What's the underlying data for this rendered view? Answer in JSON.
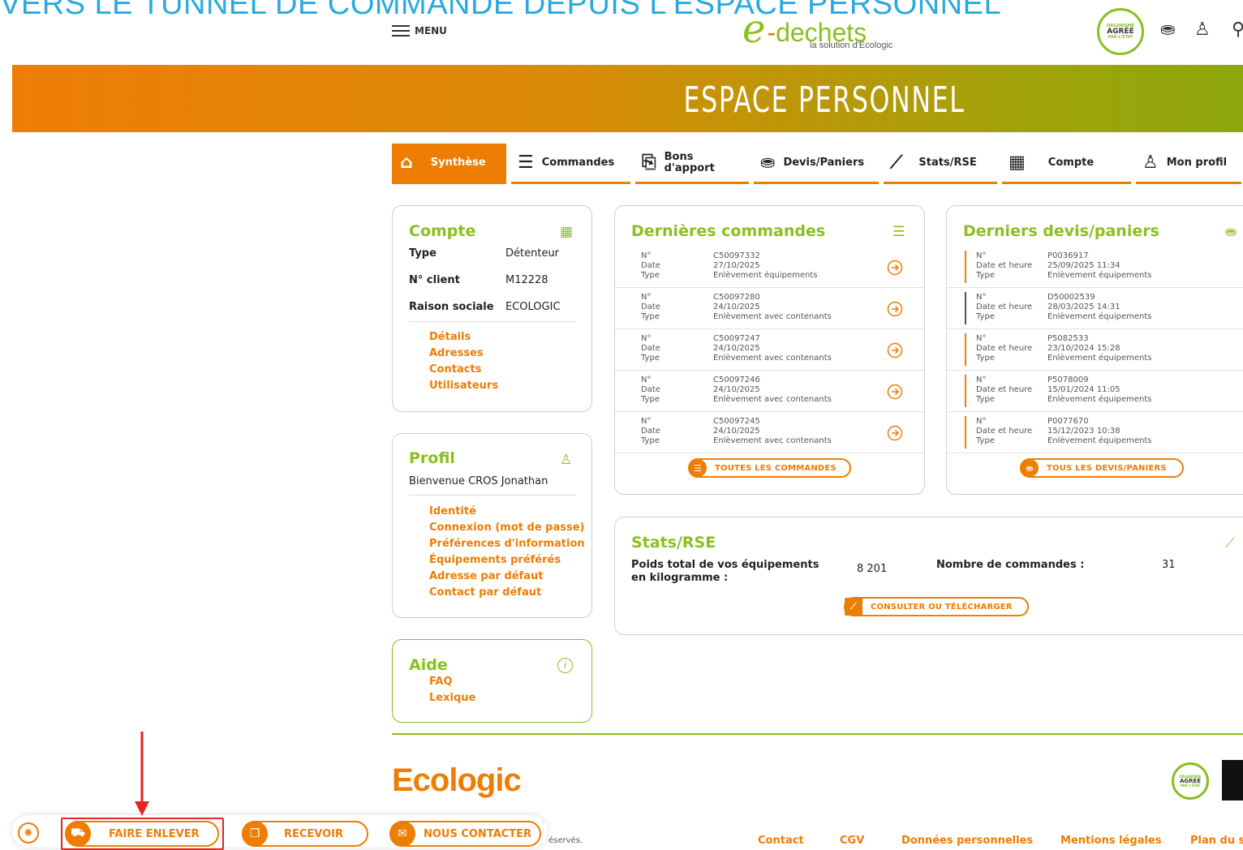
{
  "tutorial_caption": "VERS LE TUNNEL DE COMMANDE DEPUIS L'ESPACE PERSONNEL",
  "header": {
    "menu_label": "MENU",
    "logo": {
      "e": "e",
      "dash": "-",
      "word": "dechets",
      "tagline": "la solution d'Ecologic"
    },
    "seal": {
      "l1": "ORGANISME",
      "l2": "AGRÉÉ",
      "l3": "PAR L'ÉTAT"
    },
    "icons": [
      "basket-icon",
      "user-icon",
      "search-icon"
    ]
  },
  "banner": {
    "title": "ESPACE PERSONNEL"
  },
  "tabs": [
    {
      "label": "Synthèse",
      "icon": "⌂"
    },
    {
      "label": "Commandes",
      "icon": "☰"
    },
    {
      "label": "Bons d'apport",
      "icon": "⎘"
    },
    {
      "label": "Devis/Paniers",
      "icon": "⛂"
    },
    {
      "label": "Stats/RSE",
      "icon": "⟋"
    },
    {
      "label": "Compte",
      "icon": "▦"
    },
    {
      "label": "Mon profil",
      "icon": "♙"
    }
  ],
  "compte": {
    "title": "Compte",
    "type_label": "Type",
    "type_value": "Détenteur",
    "client_label": "N° client",
    "client_value": "M12228",
    "raison_label": "Raison sociale",
    "raison_value": "ECOLOGIC",
    "links": [
      "Détails",
      "Adresses",
      "Contacts",
      "Utilisateurs"
    ]
  },
  "profil": {
    "title": "Profil",
    "welcome": "Bienvenue CROS Jonathan",
    "links": [
      "Identité",
      "Connexion (mot de passe)",
      "Préférences d'information",
      "Équipements préférés",
      "Adresse par défaut",
      "Contact par défaut"
    ]
  },
  "aide": {
    "title": "Aide",
    "links": [
      "FAQ",
      "Lexique"
    ]
  },
  "commandes": {
    "title": "Dernières commandes",
    "labels": [
      "N°",
      "Date",
      "Type"
    ],
    "rows": [
      {
        "num": "C50097332",
        "date": "27/10/2025",
        "type": "Enlèvement équipements"
      },
      {
        "num": "C50097280",
        "date": "24/10/2025",
        "type": "Enlèvement avec contenants"
      },
      {
        "num": "C50097247",
        "date": "24/10/2025",
        "type": "Enlèvement avec contenants"
      },
      {
        "num": "C50097246",
        "date": "24/10/2025",
        "type": "Enlèvement avec contenants"
      },
      {
        "num": "C50097245",
        "date": "24/10/2025",
        "type": "Enlèvement avec contenants"
      }
    ],
    "button": "TOUTES LES COMMANDES"
  },
  "devis": {
    "title": "Derniers devis/paniers",
    "labels": [
      "N°",
      "Date et heure",
      "Type"
    ],
    "rows": [
      {
        "num": "P0036917",
        "date": "25/09/2025 11:34",
        "type": "Enlèvement équipements"
      },
      {
        "num": "D50002539",
        "date": "28/03/2025 14:31",
        "type": "Enlèvement équipements"
      },
      {
        "num": "P5082533",
        "date": "23/10/2024 15:28",
        "type": "Enlèvement équipements"
      },
      {
        "num": "P5078009",
        "date": "15/01/2024 11:05",
        "type": "Enlèvement équipements"
      },
      {
        "num": "P0077670",
        "date": "15/12/2023 10:38",
        "type": "Enlèvement équipements"
      }
    ],
    "button": "TOUS LES DEVIS/PANIERS"
  },
  "stats": {
    "title": "Stats/RSE",
    "poids_label": "Poids total de vos équipements en kilogramme :",
    "poids_value": "8 201",
    "nb_label": "Nombre de commandes :",
    "nb_value": "31",
    "button": "CONSULTER OU TÉLÉCHARGER"
  },
  "footer": {
    "brand_a": "Eco",
    "brand_b": "logic",
    "rights": "éservés.",
    "links": [
      "Contact",
      "CGV",
      "Données personnelles",
      "Mentions légales",
      "Plan du s"
    ]
  },
  "bottom_bar": {
    "faire_enlever": "FAIRE ENLEVER",
    "recevoir": "RECEVOIR",
    "nous_contacter": "NOUS CONTACTER"
  },
  "colors": {
    "orange": "#ee7d04",
    "green": "#8bbf20",
    "annotation_red": "#e52521",
    "caption_blue": "#2aa9e0"
  }
}
